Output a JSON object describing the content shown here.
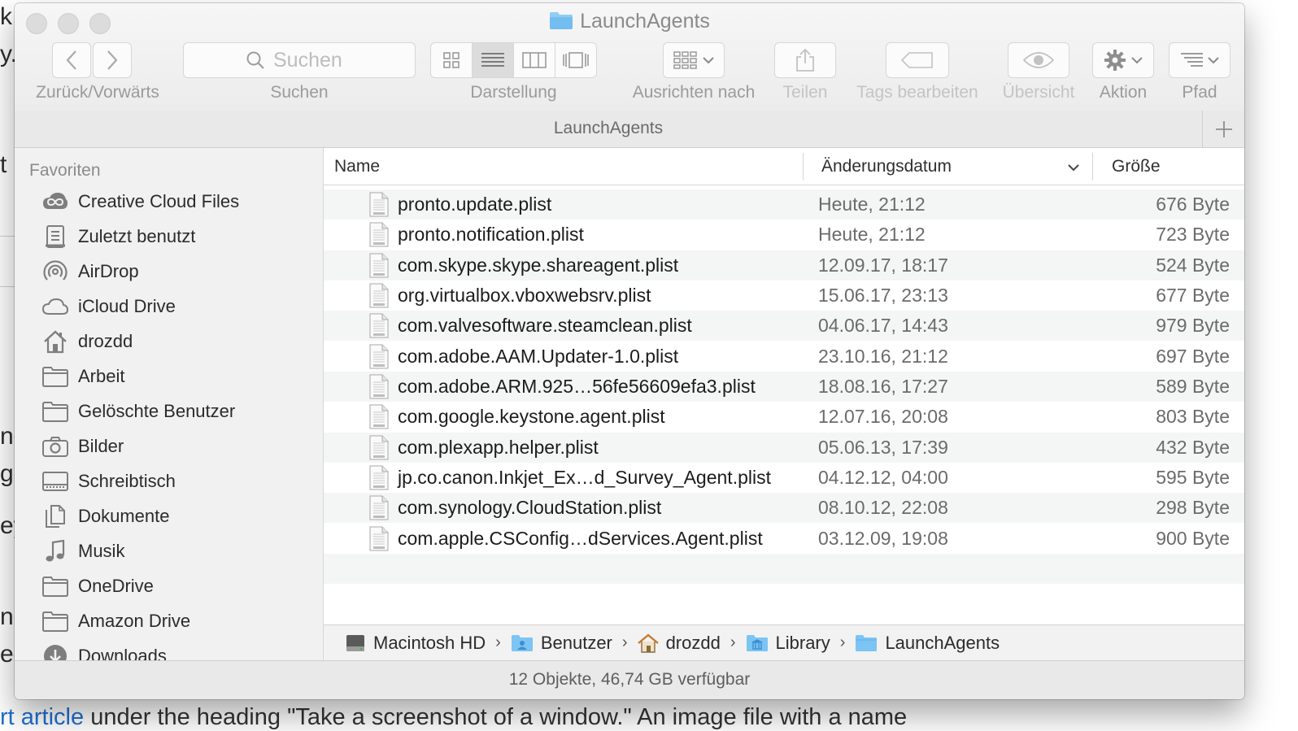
{
  "background": {
    "left_fragments": [
      "k",
      "y.",
      "t",
      "ne",
      "ge",
      "ey",
      "nc",
      "ed"
    ],
    "bottom_link": "rt article",
    "bottom_text": " under the heading \"Take a screenshot of a window.\" An image file with a name"
  },
  "window": {
    "title": "LaunchAgents",
    "toolbar": {
      "nav_label": "Zurück/Vorwärts",
      "search_placeholder": "Suchen",
      "search_label": "Suchen",
      "view_label": "Darstellung",
      "arrange_label": "Ausrichten nach",
      "share_label": "Teilen",
      "tags_label": "Tags bearbeiten",
      "quicklook_label": "Übersicht",
      "action_label": "Aktion",
      "path_label": "Pfad"
    },
    "tab_title": "LaunchAgents"
  },
  "sidebar": {
    "heading": "Favoriten",
    "items": [
      {
        "label": "Creative Cloud Files",
        "icon": "creative-cloud-icon"
      },
      {
        "label": "Zuletzt benutzt",
        "icon": "recents-icon"
      },
      {
        "label": "AirDrop",
        "icon": "airdrop-icon"
      },
      {
        "label": "iCloud Drive",
        "icon": "cloud-icon"
      },
      {
        "label": "drozdd",
        "icon": "home-icon"
      },
      {
        "label": "Arbeit",
        "icon": "folder-icon"
      },
      {
        "label": "Gelöschte Benutzer",
        "icon": "folder-icon"
      },
      {
        "label": "Bilder",
        "icon": "camera-icon"
      },
      {
        "label": "Schreibtisch",
        "icon": "desktop-icon"
      },
      {
        "label": "Dokumente",
        "icon": "documents-icon"
      },
      {
        "label": "Musik",
        "icon": "music-note-icon"
      },
      {
        "label": "OneDrive",
        "icon": "folder-icon"
      },
      {
        "label": "Amazon Drive",
        "icon": "folder-icon"
      },
      {
        "label": "Downloads",
        "icon": "download-icon"
      }
    ]
  },
  "list": {
    "columns": {
      "name": "Name",
      "date": "Änderungsdatum",
      "size": "Größe"
    },
    "files": [
      {
        "name": "pronto.update.plist",
        "date": "Heute, 21:12",
        "size": "676 Byte"
      },
      {
        "name": "pronto.notification.plist",
        "date": "Heute, 21:12",
        "size": "723 Byte"
      },
      {
        "name": "com.skype.skype.shareagent.plist",
        "date": "12.09.17, 18:17",
        "size": "524 Byte"
      },
      {
        "name": "org.virtualbox.vboxwebsrv.plist",
        "date": "15.06.17, 23:13",
        "size": "677 Byte"
      },
      {
        "name": "com.valvesoftware.steamclean.plist",
        "date": "04.06.17, 14:43",
        "size": "979 Byte"
      },
      {
        "name": "com.adobe.AAM.Updater-1.0.plist",
        "date": "23.10.16, 21:12",
        "size": "697 Byte"
      },
      {
        "name": "com.adobe.ARM.925…56fe56609efa3.plist",
        "date": "18.08.16, 17:27",
        "size": "589 Byte"
      },
      {
        "name": "com.google.keystone.agent.plist",
        "date": "12.07.16, 20:08",
        "size": "803 Byte"
      },
      {
        "name": "com.plexapp.helper.plist",
        "date": "05.06.13, 17:39",
        "size": "432 Byte"
      },
      {
        "name": "jp.co.canon.Inkjet_Ex…d_Survey_Agent.plist",
        "date": "04.12.12, 04:00",
        "size": "595 Byte"
      },
      {
        "name": "com.synology.CloudStation.plist",
        "date": "08.10.12, 22:08",
        "size": "298 Byte"
      },
      {
        "name": "com.apple.CSConfig…dServices.Agent.plist",
        "date": "03.12.09, 19:08",
        "size": "900 Byte"
      }
    ]
  },
  "pathbar": {
    "crumbs": [
      {
        "label": "Macintosh HD",
        "icon": "hard-drive-icon"
      },
      {
        "label": "Benutzer",
        "icon": "users-folder-icon"
      },
      {
        "label": "drozdd",
        "icon": "home-icon"
      },
      {
        "label": "Library",
        "icon": "library-folder-icon"
      },
      {
        "label": "LaunchAgents",
        "icon": "folder-icon"
      }
    ]
  },
  "status": "12 Objekte, 46,74 GB verfügbar",
  "colors": {
    "folder_blue": "#7cc4f4",
    "sidebar_bg": "#f1f1f1",
    "alt_row": "#f4f5f5"
  }
}
